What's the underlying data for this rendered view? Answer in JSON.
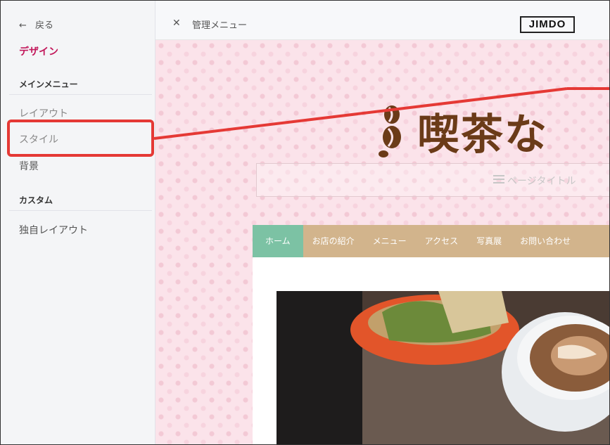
{
  "sidebar": {
    "back_label": "戻る",
    "design_title": "デザイン",
    "main_menu_label": "メインメニュー",
    "items": [
      {
        "label": "レイアウト"
      },
      {
        "label": "スタイル"
      },
      {
        "label": "背景"
      }
    ],
    "custom_label": "カスタム",
    "custom_items": [
      {
        "label": "独自レイアウト"
      }
    ]
  },
  "topbar": {
    "close_icon": "close-icon",
    "title": "管理メニュー",
    "logo": "JIMDO"
  },
  "preview": {
    "site_title": "喫茶な",
    "subtitle_placeholder": "ページタイトル",
    "menu": [
      "ホーム",
      "お店の紹介",
      "メニュー",
      "アクセス",
      "写真展",
      "お問い合わせ"
    ],
    "colors": {
      "accent": "#c2185b",
      "highlight": "#e53935",
      "menu_bg": "#d2b48c",
      "menu_active": "#7cc2a4",
      "title_brown": "#6b3b18"
    }
  }
}
